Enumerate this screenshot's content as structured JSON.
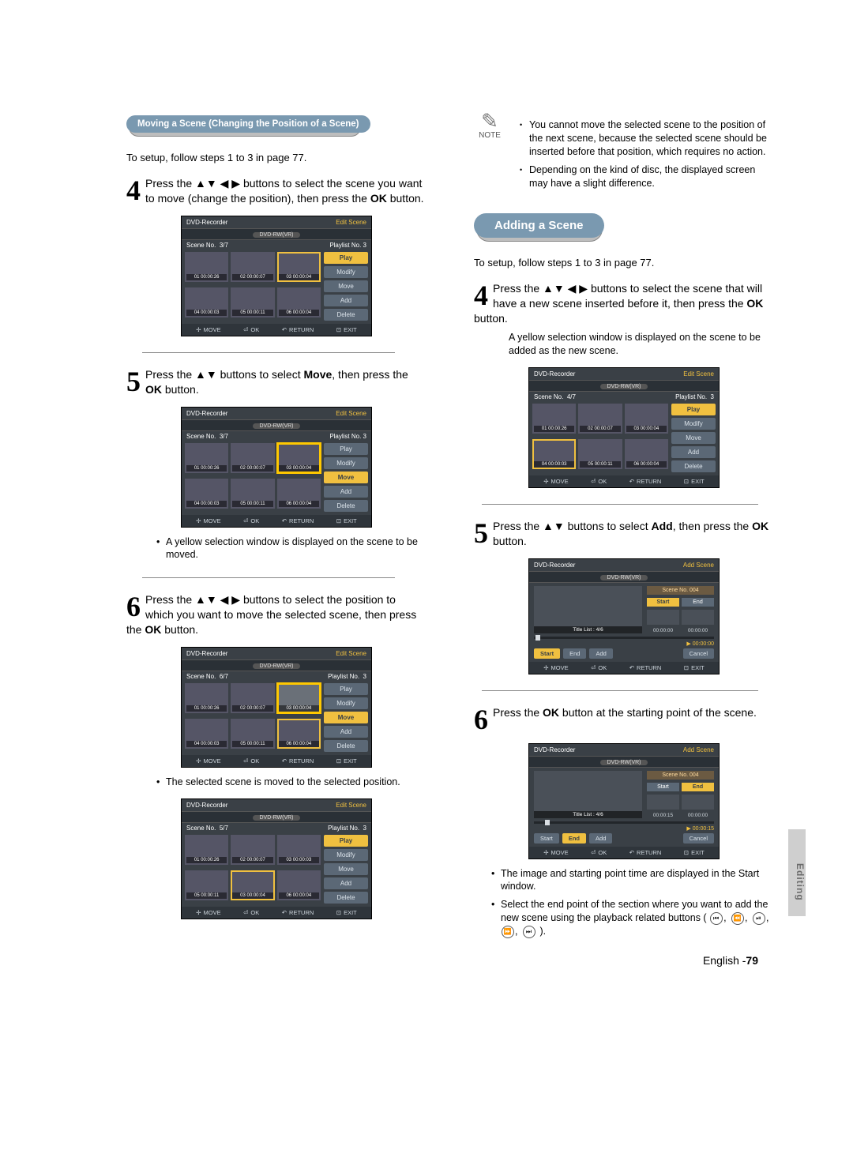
{
  "headers": {
    "moving": "Moving a Scene (Changing the Position of a Scene)",
    "adding": "Adding a Scene"
  },
  "setup_line": "To setup, follow steps 1 to 3 in page 77.",
  "arrows4": "▲▼ ◀ ▶",
  "arrows2": "▲▼",
  "left": {
    "s4": {
      "num": "4",
      "t1": "Press the ",
      "t2": " buttons to select the scene you want to move (change the position), then press the ",
      "ok": "OK",
      "t3": " button."
    },
    "s5": {
      "num": "5",
      "t1": "Press the ",
      "t2": " buttons to select ",
      "move": "Move",
      "t3": ", then press the ",
      "ok": "OK",
      "t4": " button."
    },
    "s5_note": "A yellow selection window is displayed on the scene to be moved.",
    "s6": {
      "num": "6",
      "t1": "Press the ",
      "t2": " buttons to select the position to which you want to move the selected scene, then press the ",
      "ok": "OK",
      "t3": " button."
    },
    "s6_note": "The selected scene is moved to the selected position."
  },
  "right": {
    "note1": "You cannot move the selected scene to the position of the next scene, because the selected scene should be inserted before that position, which requires no action.",
    "note2": "Depending on the kind of disc, the displayed screen may have a slight difference.",
    "note_label": "NOTE",
    "s4": {
      "num": "4",
      "t1": "Press the ",
      "t2": " buttons to select the scene that will have a new scene inserted before it, then press the ",
      "ok": "OK",
      "t3": " button."
    },
    "s4_sub": "A yellow selection window is displayed on the scene to be added as the new scene.",
    "s5": {
      "num": "5",
      "t1": "Press the ",
      "t2": " buttons to select ",
      "add": "Add",
      "t3": ", then press the ",
      "ok": "OK",
      "t4": " button."
    },
    "s6": {
      "num": "6",
      "t1": "Press the ",
      "ok": "OK",
      "t2": " button at the starting point of the scene."
    },
    "b1": "The image and starting point time are displayed in the Start window.",
    "b2_a": "Select the end point of the section where you want to add the new scene using the playback related buttons (",
    "b2_b": ")."
  },
  "osd": {
    "rec": "DVD-Recorder",
    "edit": "Edit Scene",
    "addscene": "Add Scene",
    "disc": "DVD-RW(VR)",
    "scene": "Scene No.",
    "pl": "Playlist No.",
    "pl3": "Playlist No. 3",
    "menu": {
      "play": "Play",
      "modify": "Modify",
      "move": "Move",
      "add": "Add",
      "delete": "Delete"
    },
    "nav": {
      "move": "MOVE",
      "ok": "OK",
      "return": "RETURN",
      "exit": "EXIT"
    },
    "caps": [
      "01  00:00:26",
      "02  00:00:07",
      "03  00:00:04",
      "04  00:00:03",
      "05  00:00:11",
      "06  00:00:04"
    ],
    "caps_b": [
      "01  00:00:26",
      "02  00:00:07",
      "03  00:00:03",
      "04  00:00:03",
      "05  00:00:11",
      "06  00:00:04"
    ],
    "sn": {
      "a": "3/7",
      "b": "3/7",
      "c": "6/7",
      "d": "5/7",
      "r4": "4/7"
    },
    "pl_side3": "3",
    "add": {
      "scene_no": "Scene No. 004",
      "start": "Start",
      "end": "End",
      "addb": "Add",
      "cancel": "Cancel",
      "tl": "Title List : 4/6",
      "z": "00:00:00",
      "z2": "00:00:00",
      "p0": "00:00:00",
      "t15": "00:00:15",
      "p15": "00:00:15"
    }
  },
  "side_tab": "Editing",
  "footer": {
    "lang": "English -",
    "page": "79"
  },
  "pb_icons": [
    "⏮",
    "⏪",
    "⏯",
    "⏩",
    "⏭"
  ]
}
